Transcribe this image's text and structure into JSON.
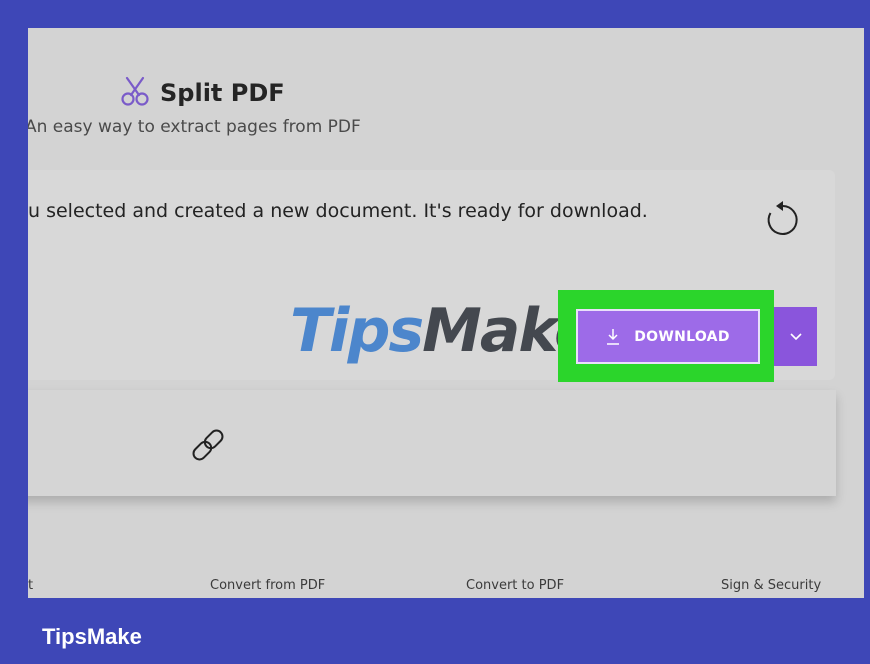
{
  "header": {
    "title": "Split PDF",
    "subtitle": "An easy way to extract pages from PDF",
    "icon": "scissors-icon"
  },
  "result": {
    "message": "u selected and created a new document. It's ready for download.",
    "reset_icon": "rotate-ccw-icon"
  },
  "actions": {
    "download_label": "DOWNLOAD",
    "download_icon": "download-icon",
    "dropdown_icon": "chevron-down-icon",
    "accent": "#9d6be8",
    "highlight_color": "#2bd52b"
  },
  "share": {
    "icon": "link-icon"
  },
  "watermark": {
    "part1": "Tips",
    "part2": "Make"
  },
  "footer_nav": {
    "items": [
      "t",
      "Convert from PDF",
      "Convert to PDF",
      "Sign & Security"
    ]
  },
  "brand": {
    "name": "TipsMake"
  }
}
